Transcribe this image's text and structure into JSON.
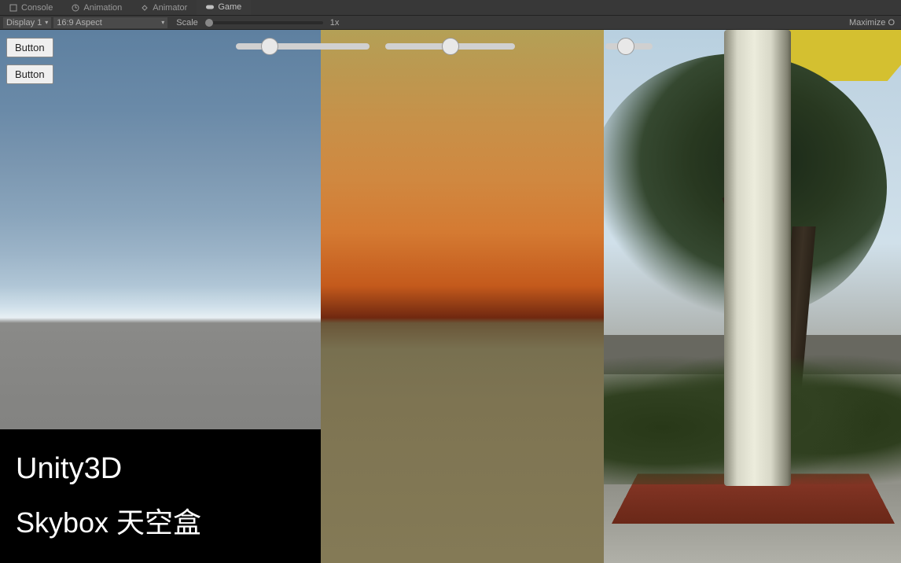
{
  "tabs": {
    "console": "Console",
    "animation": "Animation",
    "animator": "Animator",
    "game": "Game"
  },
  "toolbar": {
    "display": "Display 1",
    "aspect": "16:9 Aspect",
    "scale_label": "Scale",
    "scale_value": "1x",
    "maximize": "Maximize O"
  },
  "ui": {
    "button_1_label": "Button",
    "button_2_label": "Button"
  },
  "sliders": {
    "slider_1_value": 20,
    "slider_2_value": 45,
    "slider_3_value": 25
  },
  "caption": {
    "line_1": "Unity3D",
    "line_2": "Skybox 天空盒"
  }
}
